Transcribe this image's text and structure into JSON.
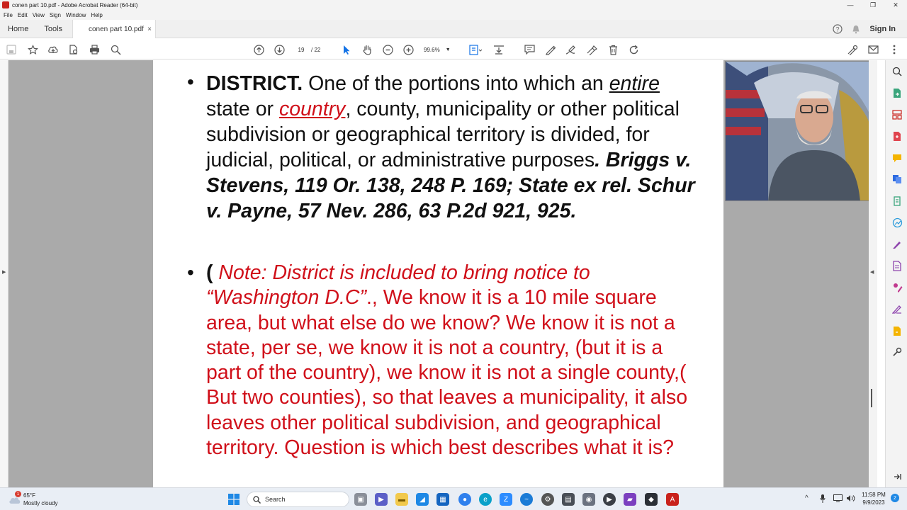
{
  "window": {
    "title": "conen part 10.pdf - Adobe Acrobat Reader (64-bit)",
    "controls": [
      "—",
      "❐",
      "✕"
    ]
  },
  "menu": [
    "File",
    "Edit",
    "View",
    "Sign",
    "Window",
    "Help"
  ],
  "tabs": {
    "home": "Home",
    "tools": "Tools",
    "document": "conen part 10.pdf",
    "close": "×",
    "sign_in": "Sign In"
  },
  "toolbar": {
    "current_page": "19",
    "total_pages": "/ 22",
    "zoom": "99.6%"
  },
  "slide": {
    "bullet_char": "•",
    "p1": {
      "term": "DISTRICT.",
      "t1": " One of the portions into which an ",
      "entire": "entire",
      "t2": " state or ",
      "country": "country",
      "t3": ", county, municipality or other political subdivision or geographical territory is divided, for judicial, political, or administrative purposes",
      "citation": ". Briggs v. Stevens, 119 Or. 138, 248 P. 169; State ex rel. Schur v. Payne, 57 Nev. 286, 63 P.2d 921, 925."
    },
    "p2": {
      "paren": "(",
      "note_italic": " Note: District is included to bring notice to “Washington D.C”",
      "rest": "., We know it is a 10 mile square area, but what else do we know? We know it is not a state, per se, we know it is not a country, (but it is a part of the country), we know it is not a single county,( But two counties), so that leaves a municipality, it also leaves other political subdivision, and geographical territory. Question is which best describes what it is?"
    }
  },
  "taskbar": {
    "weather_temp": "65°F",
    "weather_condition": "Mostly cloudy",
    "weather_badge": "1",
    "search_placeholder": "Search",
    "time": "11:58 PM",
    "date": "9/9/2023"
  },
  "colors": {
    "accent_red": "#d0101a",
    "acrobat_red": "#c9221c",
    "select_blue": "#1473e6"
  }
}
